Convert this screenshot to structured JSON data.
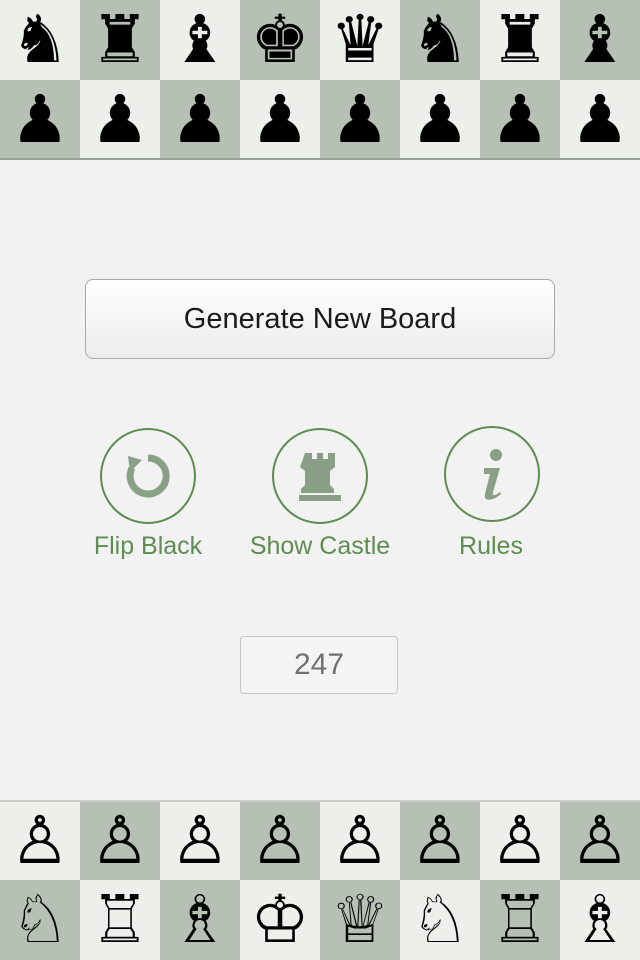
{
  "top_board": {
    "back_rank": [
      "♞",
      "♜",
      "♝",
      "♚",
      "♛",
      "♞",
      "♜",
      "♝"
    ],
    "pawn_rank": [
      "♟",
      "♟",
      "♟",
      "♟",
      "♟",
      "♟",
      "♟",
      "♟"
    ]
  },
  "bottom_board": {
    "pawn_rank": [
      "♙",
      "♙",
      "♙",
      "♙",
      "♙",
      "♙",
      "♙",
      "♙"
    ],
    "back_rank": [
      "♘",
      "♖",
      "♗",
      "♔",
      "♕",
      "♘",
      "♖",
      "♗"
    ]
  },
  "generate_button": {
    "label": "Generate New Board"
  },
  "actions": [
    {
      "id": "flip-black",
      "label": "Flip Black",
      "icon": "refresh-icon"
    },
    {
      "id": "show-castle",
      "label": "Show Castle",
      "icon": "rook-icon"
    },
    {
      "id": "rules",
      "label": "Rules",
      "icon": "info-icon"
    }
  ],
  "counter": {
    "value": "247"
  },
  "colors": {
    "accent": "#5f8c52",
    "light_square": "#ecefea",
    "dark_square": "#b6c0b4"
  }
}
